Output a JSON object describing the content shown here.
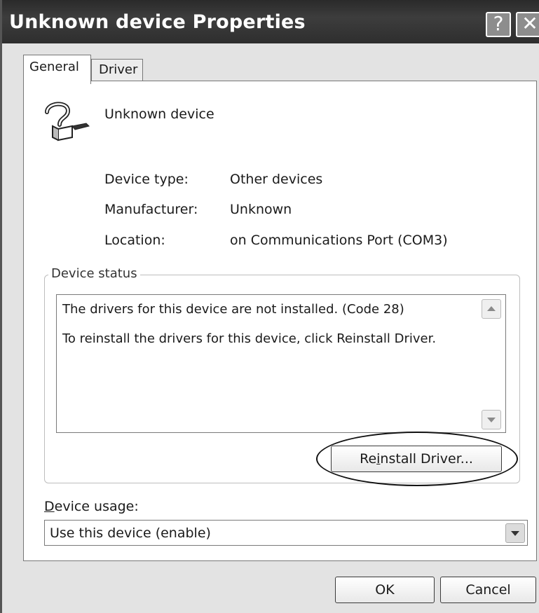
{
  "window": {
    "title": "Unknown device Properties",
    "help_label": "?",
    "close_label": "✕"
  },
  "tabs": [
    {
      "label": "General",
      "selected": true
    },
    {
      "label": "Driver",
      "selected": false
    }
  ],
  "device": {
    "icon": "unknown-device-question-icon",
    "name": "Unknown device",
    "properties": [
      {
        "label": "Device type:",
        "value": "Other devices"
      },
      {
        "label": "Manufacturer:",
        "value": "Unknown"
      },
      {
        "label": "Location:",
        "value": "on Communications Port (COM3)"
      }
    ]
  },
  "status": {
    "group_title": "Device status",
    "lines": [
      "The drivers for this device are not installed. (Code 28)",
      "To reinstall the drivers for this device, click Reinstall Driver."
    ],
    "reinstall_prefix": "Re",
    "reinstall_accel": "i",
    "reinstall_suffix": "nstall Driver..."
  },
  "usage": {
    "label_accel": "D",
    "label_rest": "evice usage:",
    "selected": "Use this device (enable)"
  },
  "buttons": {
    "ok": "OK",
    "cancel": "Cancel"
  }
}
